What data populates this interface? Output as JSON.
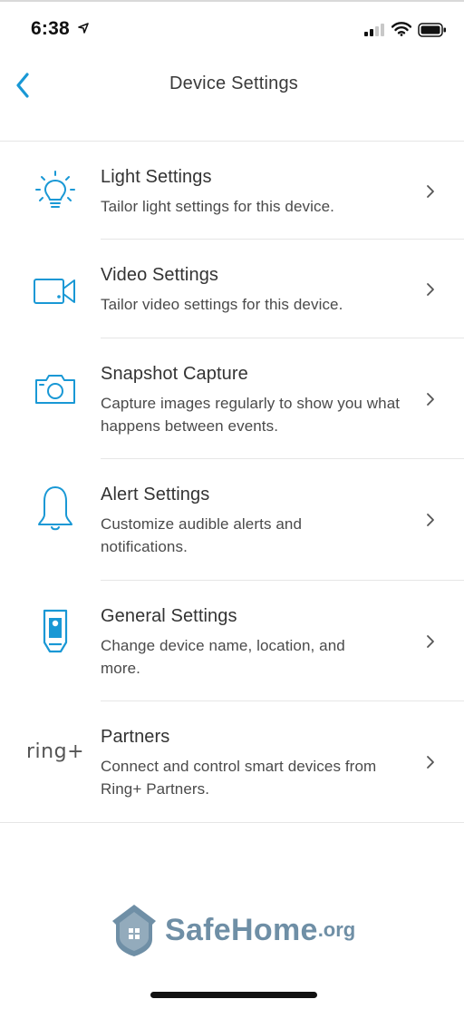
{
  "status_bar": {
    "time": "6:38",
    "icons": [
      "location-arrow-icon",
      "cellular-signal-icon",
      "wifi-icon",
      "battery-icon"
    ]
  },
  "nav": {
    "title": "Device Settings",
    "back_icon": "chevron-left-icon"
  },
  "settings": [
    {
      "title": "Light Settings",
      "description": "Tailor light settings for this device.",
      "icon": "lightbulb-icon"
    },
    {
      "title": "Video Settings",
      "description": "Tailor video settings for this device.",
      "icon": "video-camera-icon"
    },
    {
      "title": "Snapshot Capture",
      "description": "Capture images regularly to show you what happens between events.",
      "icon": "camera-icon"
    },
    {
      "title": "Alert Settings",
      "description": "Customize audible alerts and notifications.",
      "icon": "bell-icon"
    },
    {
      "title": "General Settings",
      "description": "Change device name, location, and more.",
      "icon": "device-icon"
    },
    {
      "title": "Partners",
      "description": "Connect and control smart devices from Ring+ Partners.",
      "icon": "ring-plus-logo",
      "icon_text": "ring+"
    }
  ],
  "watermark": {
    "brand": "SafeHome",
    "suffix": ".org"
  },
  "colors": {
    "accent": "#1998d5",
    "text": "#333333",
    "divider": "#e6e6e6",
    "watermark": "#6f8fa6"
  }
}
